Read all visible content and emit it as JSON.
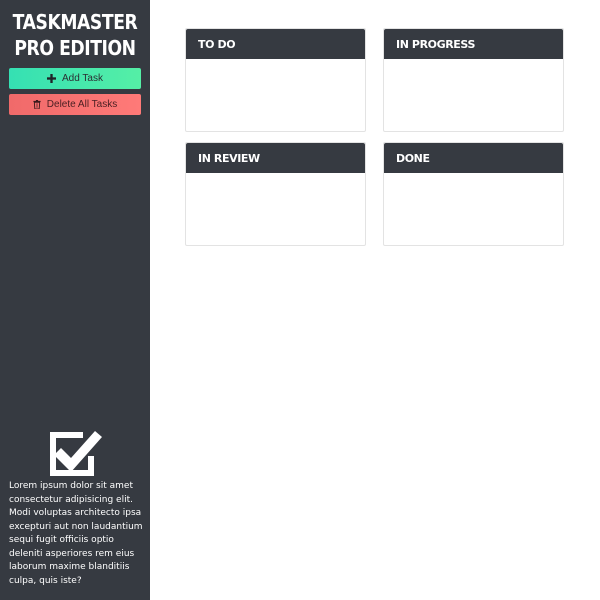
{
  "sidebar": {
    "brand_line1": "TASKMASTER",
    "brand_line2": "PRO EDITION",
    "add_button": {
      "label": "Add Task",
      "icon": "plus-icon",
      "color": "#3ee8b0"
    },
    "delete_button": {
      "label": "Delete All Tasks",
      "icon": "trash-icon",
      "color": "#f76d6d"
    },
    "logo_icon": "checkbox-check-icon",
    "description": "Lorem ipsum dolor sit amet consectetur adipisicing elit. Modi voluptas architecto ipsa excepturi aut non laudantium sequi fugit officiis optio deleniti asperiores rem eius laborum maxime blanditiis culpa, quis iste?"
  },
  "board": {
    "columns": [
      {
        "title": "TO DO"
      },
      {
        "title": "IN PROGRESS"
      },
      {
        "title": "IN REVIEW"
      },
      {
        "title": "DONE"
      }
    ]
  },
  "colors": {
    "sidebar_bg": "#363a41",
    "header_bg": "#363a41",
    "card_border": "#e3e3e3"
  }
}
